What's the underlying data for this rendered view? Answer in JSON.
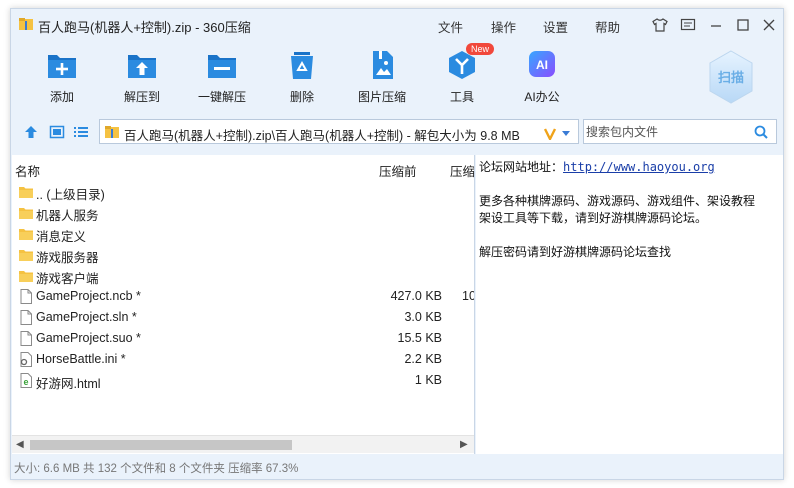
{
  "window": {
    "title": "百人跑马(机器人+控制).zip - 360压缩",
    "menu": [
      "文件",
      "操作",
      "设置",
      "帮助"
    ]
  },
  "toolbar": {
    "tools": [
      {
        "label": "添加",
        "icon": "add-file-icon"
      },
      {
        "label": "解压到",
        "icon": "extract-to-icon"
      },
      {
        "label": "一键解压",
        "icon": "one-click-extract-icon"
      },
      {
        "label": "删除",
        "icon": "recycle-bin-icon"
      },
      {
        "label": "图片压缩",
        "icon": "image-compress-icon"
      },
      {
        "label": "工具",
        "icon": "tools-icon",
        "badge": "New"
      },
      {
        "label": "AI办公",
        "icon": "ai-office-icon",
        "glyph": "AI"
      }
    ],
    "scan_label": "扫描"
  },
  "address": {
    "path": "百人跑马(机器人+控制).zip\\百人跑马(机器人+控制) - 解包大小为 9.8 MB",
    "search_placeholder": "搜索包内文件"
  },
  "file_list": {
    "columns": [
      "名称",
      "压缩前",
      "压缩"
    ],
    "rows": [
      {
        "name": ".. (上级目录)",
        "type": "folder",
        "size": "",
        "comp": ""
      },
      {
        "name": "机器人服务",
        "type": "folder",
        "size": "",
        "comp": ""
      },
      {
        "name": "消息定义",
        "type": "folder",
        "size": "",
        "comp": ""
      },
      {
        "name": "游戏服务器",
        "type": "folder",
        "size": "",
        "comp": ""
      },
      {
        "name": "游戏客户端",
        "type": "folder",
        "size": "",
        "comp": ""
      },
      {
        "name": "GameProject.ncb *",
        "type": "file",
        "size": "427.0 KB",
        "comp": "10"
      },
      {
        "name": "GameProject.sln *",
        "type": "file",
        "size": "3.0 KB",
        "comp": ""
      },
      {
        "name": "GameProject.suo *",
        "type": "file",
        "size": "15.5 KB",
        "comp": ""
      },
      {
        "name": "HorseBattle.ini *",
        "type": "ini",
        "size": "2.2 KB",
        "comp": ""
      },
      {
        "name": "好游网.html",
        "type": "html",
        "size": "1 KB",
        "comp": ""
      }
    ]
  },
  "comment": {
    "line1_prefix": "论坛网站地址：",
    "line1_link": "http://www.haoyou.org",
    "line2": "更多各种棋牌源码、游戏源码、游戏组件、架设教程",
    "line3": "架设工具等下载，请到好游棋牌源码论坛。",
    "line4": "解压密码请到好游棋牌源码论坛查找"
  },
  "status": {
    "text": "大小: 6.6 MB 共 132 个文件和 8 个文件夹 压缩率 67.3%"
  },
  "colors": {
    "accent": "#1a73c8",
    "window_bg": "#eaf2fb",
    "folder": "#f5c242",
    "badge": "#f1483b"
  }
}
